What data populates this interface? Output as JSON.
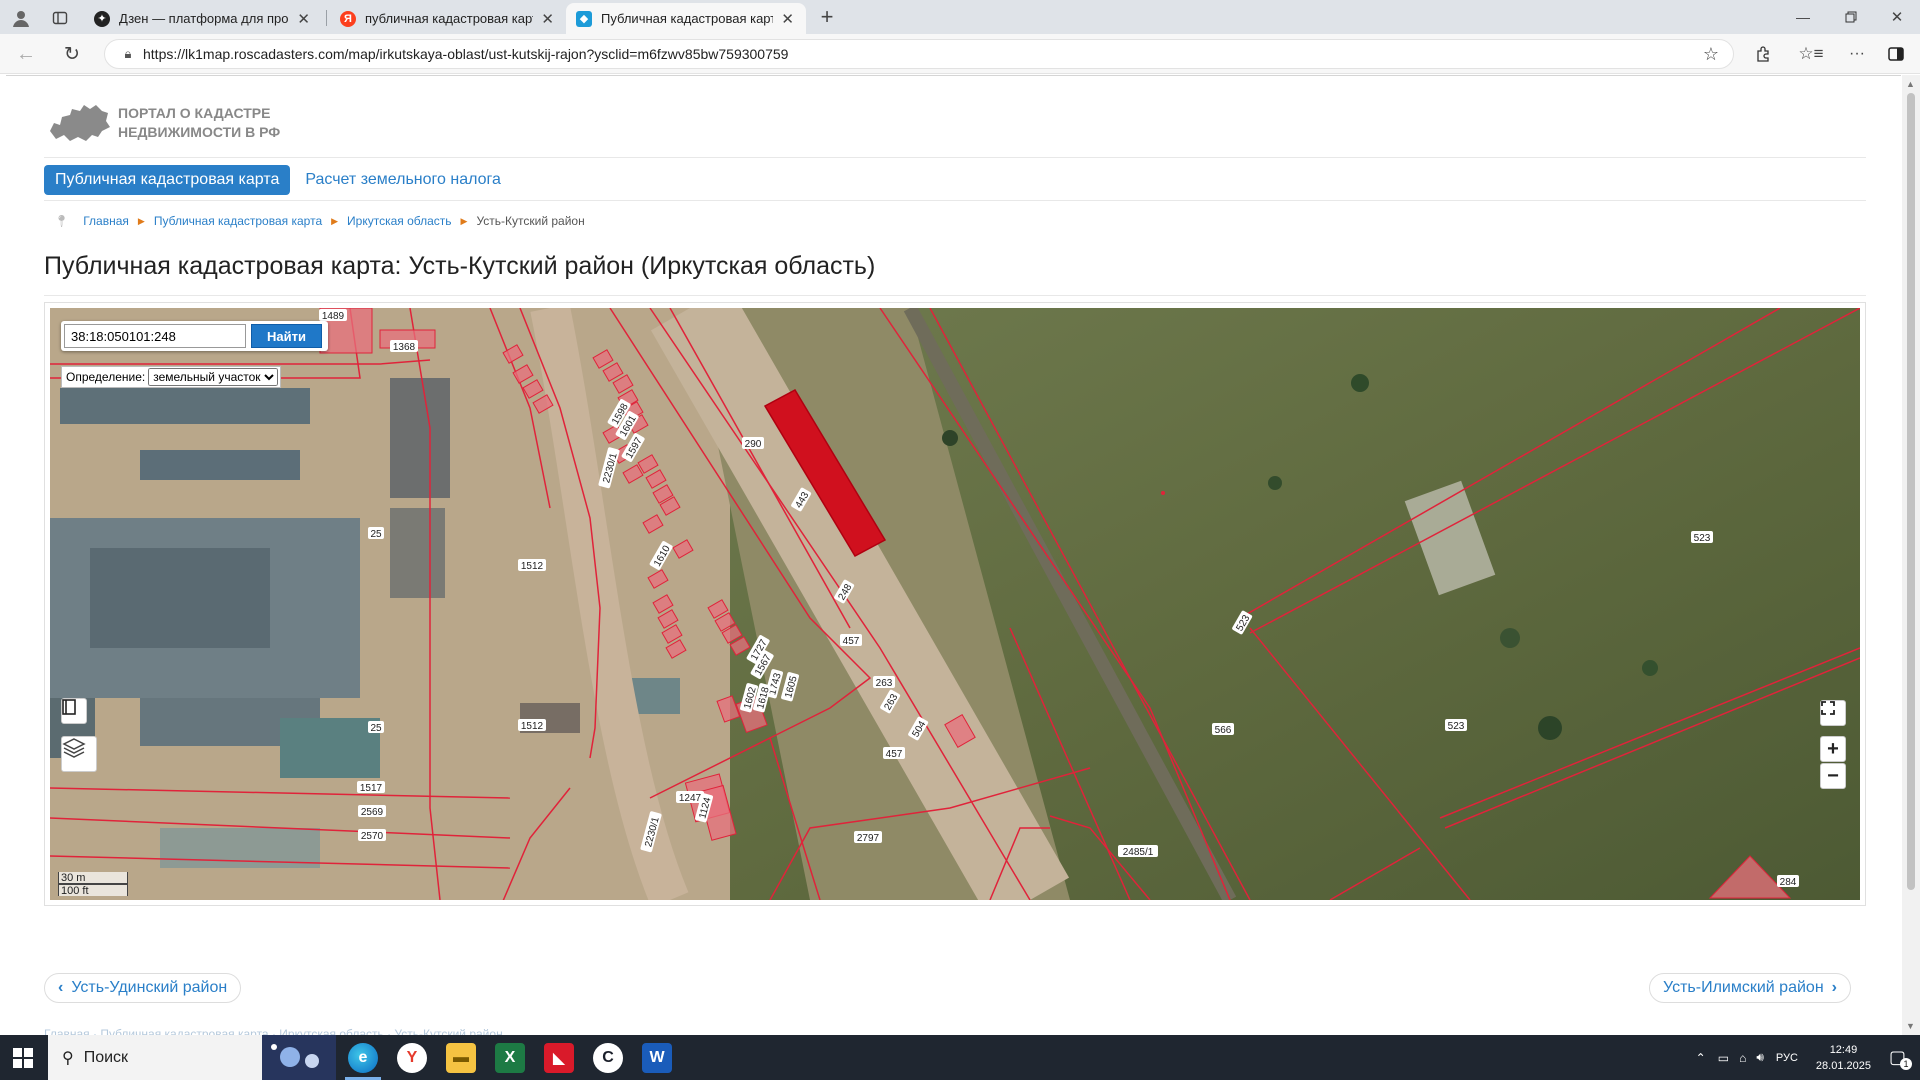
{
  "browser": {
    "tabs": [
      {
        "title": "Дзен — платформа для просмотра",
        "favicon": "zen-icon",
        "favicon_color": "#222222"
      },
      {
        "title": "публичная кадастровая карта усть",
        "favicon": "yandex-icon",
        "favicon_color": "#fc3f1d"
      },
      {
        "title": "Публичная кадастровая карта: Усть",
        "favicon": "roscadasters-icon",
        "favicon_color": "#1d9bd8"
      }
    ],
    "url": "https://lk1map.roscadasters.com/map/irkutskaya-oblast/ust-kutskij-rajon?ysclid=m6fzwv85bw759300759"
  },
  "logo": {
    "line1": "ПОРТАЛ О КАДАСТРЕ",
    "line2": "НЕДВИЖИМОСТИ В РФ"
  },
  "nav": {
    "active": "Публичная кадастровая карта",
    "link": "Расчет земельного налога"
  },
  "breadcrumb": [
    "Главная",
    "Публичная кадастровая карта",
    "Иркутская область"
  ],
  "breadcrumb_current": "Усть-Кутский район",
  "page_title": "Публичная кадастровая карта: Усть-Кутский район (Иркутская область)",
  "map": {
    "search_value": "38:18:050101:248",
    "search_button": "Найти",
    "definition_label": "Определение:",
    "definition_selected": "земельный участок",
    "scale_metric": "30 m",
    "scale_imperial": "100 ft",
    "zoom_in": "+",
    "zoom_out": "−",
    "parcel_labels": [
      "1489",
      "1368",
      "1598",
      "1601",
      "1597",
      "2230/1",
      "25",
      "1512",
      "1610",
      "290",
      "443",
      "248",
      "1727",
      "1567",
      "457",
      "263",
      "263",
      "1743",
      "1618",
      "1602",
      "1605",
      "1512",
      "25",
      "457",
      "504",
      "1517",
      "1247",
      "1124",
      "2569",
      "2230/1",
      "2570",
      "2797",
      "2485/1",
      "566",
      "523",
      "523",
      "523",
      "284"
    ],
    "parcel_color": "#e0233a",
    "highlight_color": "#d0101e"
  },
  "pager": {
    "prev": "Усть-Удинский район",
    "next": "Усть-Илимский район"
  },
  "footer_faded": "Главная · Публичная кадастровая карта · Иркутская область · Усть-Кутский район",
  "taskbar": {
    "search_label": "Поиск",
    "lang": "РУС",
    "time": "12:49",
    "date": "28.01.2025",
    "notification_count": "1"
  }
}
